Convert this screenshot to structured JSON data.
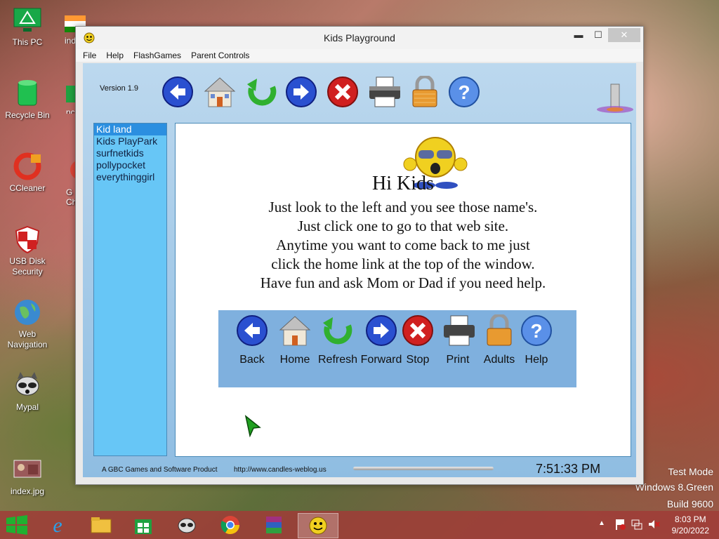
{
  "desktop": {
    "icons": [
      {
        "label": "This PC"
      },
      {
        "label": "Recycle Bin"
      },
      {
        "label": "CCleaner"
      },
      {
        "label": "USB Disk Security"
      },
      {
        "label": "Web Navigation"
      },
      {
        "label": "Mypal"
      },
      {
        "label": "index.jpg"
      }
    ],
    "partial_labels": [
      "ind",
      "nc",
      "G",
      "Ch"
    ]
  },
  "window": {
    "title": "Kids Playground",
    "minimize": "▬",
    "maximize": "☐",
    "close": "✕",
    "menu": [
      "File",
      "Help",
      "FlashGames",
      "Parent Controls"
    ],
    "version": "Version 1.9",
    "sites": [
      "Kid land",
      "Kids PlayPark",
      "surfnetkids",
      "pollypocket",
      "everythinggirl"
    ],
    "selected_site": 0,
    "greeting": "Hi Kids",
    "instructions": [
      "Just look to the left and you see those name's.",
      "Just click one to go to that web site.",
      "Anytime you want to come back to me just",
      "click the home link at the top of the window.",
      "Have fun and ask Mom or Dad if you need help."
    ],
    "nav_buttons": [
      "Back",
      "Home",
      "Refresh",
      "Forward",
      "Stop",
      "Print",
      "Adults",
      "Help"
    ],
    "status_text": "A GBC Games and Software Product",
    "status_url": "http://www.candles-weblog.us",
    "clock": "7:51:33 PM"
  },
  "watermark": [
    "Test Mode",
    "Windows 8.Green",
    "Build 9600"
  ],
  "tray": {
    "time": "8:03 PM",
    "date": "9/20/2022"
  },
  "colors": {
    "accent_blue": "#2b8fe0",
    "list_bg": "#67c6f6",
    "nav_bg": "#7fb0de"
  }
}
